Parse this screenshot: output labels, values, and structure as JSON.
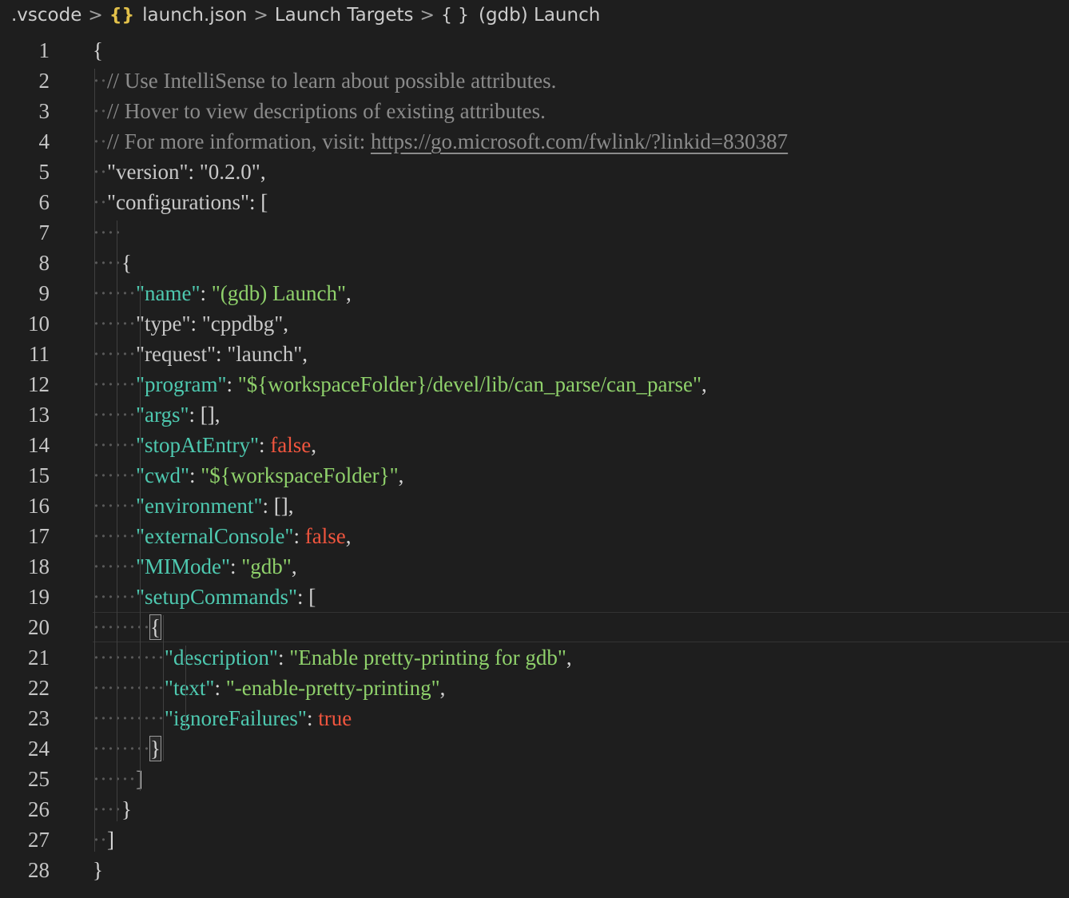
{
  "breadcrumb": {
    "folder": ".vscode",
    "file_icon": "{}",
    "file": "launch.json",
    "section": "Launch Targets",
    "object_icon": "{ }",
    "object": "(gdb) Launch",
    "separator": ">"
  },
  "icons": {
    "json_file_icon": "json-curly-braces-icon",
    "object_icon": "object-braces-icon",
    "chevron": "chevron-right-icon"
  },
  "colors": {
    "background": "#1e1e1e",
    "key": "#4ec9b0",
    "string": "#8fd16b",
    "keyword": "#f0553e",
    "comment": "#8b8b8b",
    "json_icon": "#e2c04a"
  },
  "editor": {
    "current_line": 20,
    "lines": [
      {
        "n": "1",
        "indent": "",
        "tokens": [
          {
            "t": "{",
            "c": "punc"
          }
        ]
      },
      {
        "n": "2",
        "indent": "··",
        "tokens": [
          {
            "t": "// Use IntelliSense to learn about possible attributes.",
            "c": "cm"
          }
        ]
      },
      {
        "n": "3",
        "indent": "··",
        "tokens": [
          {
            "t": "// Hover to view descriptions of existing attributes.",
            "c": "cm"
          }
        ]
      },
      {
        "n": "4",
        "indent": "··",
        "tokens": [
          {
            "t": "// For more information, visit: ",
            "c": "cm"
          },
          {
            "t": "https://go.microsoft.com/fwlink/?linkid=830387",
            "c": "link"
          }
        ]
      },
      {
        "n": "5",
        "indent": "··",
        "tokens": [
          {
            "t": "\"version\"",
            "c": "keyg"
          },
          {
            "t": ": ",
            "c": "punc"
          },
          {
            "t": "\"0.2.0\"",
            "c": "strg"
          },
          {
            "t": ",",
            "c": "punc"
          }
        ]
      },
      {
        "n": "6",
        "indent": "··",
        "tokens": [
          {
            "t": "\"configurations\"",
            "c": "keyg"
          },
          {
            "t": ": [",
            "c": "punc"
          }
        ]
      },
      {
        "n": "7",
        "indent": "····",
        "tokens": []
      },
      {
        "n": "8",
        "indent": "····",
        "tokens": [
          {
            "t": "{",
            "c": "punc"
          }
        ]
      },
      {
        "n": "9",
        "indent": "······",
        "tokens": [
          {
            "t": "\"name\"",
            "c": "key"
          },
          {
            "t": ": ",
            "c": "punc"
          },
          {
            "t": "\"(gdb) Launch\"",
            "c": "str"
          },
          {
            "t": ",",
            "c": "punc"
          }
        ]
      },
      {
        "n": "10",
        "indent": "······",
        "tokens": [
          {
            "t": "\"type\"",
            "c": "keyg"
          },
          {
            "t": ": ",
            "c": "punc"
          },
          {
            "t": "\"cppdbg\"",
            "c": "strg"
          },
          {
            "t": ",",
            "c": "punc"
          }
        ]
      },
      {
        "n": "11",
        "indent": "······",
        "tokens": [
          {
            "t": "\"request\"",
            "c": "keyg"
          },
          {
            "t": ": ",
            "c": "punc"
          },
          {
            "t": "\"launch\"",
            "c": "strg"
          },
          {
            "t": ",",
            "c": "punc"
          }
        ]
      },
      {
        "n": "12",
        "indent": "······",
        "tokens": [
          {
            "t": "\"program\"",
            "c": "key"
          },
          {
            "t": ": ",
            "c": "punc"
          },
          {
            "t": "\"${workspaceFolder}/devel/lib/can_parse/can_parse\"",
            "c": "str"
          },
          {
            "t": ",",
            "c": "punc"
          }
        ]
      },
      {
        "n": "13",
        "indent": "······",
        "tokens": [
          {
            "t": "\"args\"",
            "c": "key"
          },
          {
            "t": ": [],",
            "c": "punc"
          }
        ]
      },
      {
        "n": "14",
        "indent": "······",
        "tokens": [
          {
            "t": "\"stopAtEntry\"",
            "c": "key"
          },
          {
            "t": ": ",
            "c": "punc"
          },
          {
            "t": "false",
            "c": "kw"
          },
          {
            "t": ",",
            "c": "punc"
          }
        ]
      },
      {
        "n": "15",
        "indent": "······",
        "tokens": [
          {
            "t": "\"cwd\"",
            "c": "key"
          },
          {
            "t": ": ",
            "c": "punc"
          },
          {
            "t": "\"${workspaceFolder}\"",
            "c": "str"
          },
          {
            "t": ",",
            "c": "punc"
          }
        ]
      },
      {
        "n": "16",
        "indent": "······",
        "tokens": [
          {
            "t": "\"environment\"",
            "c": "key"
          },
          {
            "t": ": [],",
            "c": "punc"
          }
        ]
      },
      {
        "n": "17",
        "indent": "······",
        "tokens": [
          {
            "t": "\"externalConsole\"",
            "c": "key"
          },
          {
            "t": ": ",
            "c": "punc"
          },
          {
            "t": "false",
            "c": "kw"
          },
          {
            "t": ",",
            "c": "punc"
          }
        ]
      },
      {
        "n": "18",
        "indent": "······",
        "tokens": [
          {
            "t": "\"MIMode\"",
            "c": "key"
          },
          {
            "t": ": ",
            "c": "punc"
          },
          {
            "t": "\"gdb\"",
            "c": "str"
          },
          {
            "t": ",",
            "c": "punc"
          }
        ]
      },
      {
        "n": "19",
        "indent": "······",
        "tokens": [
          {
            "t": "\"setupCommands\"",
            "c": "key"
          },
          {
            "t": ": [",
            "c": "punc"
          }
        ]
      },
      {
        "n": "20",
        "indent": "········",
        "tokens": [
          {
            "t": "{",
            "c": "punc",
            "box": true
          }
        ]
      },
      {
        "n": "21",
        "indent": "··········",
        "tokens": [
          {
            "t": "\"description\"",
            "c": "key"
          },
          {
            "t": ": ",
            "c": "punc"
          },
          {
            "t": "\"Enable pretty-printing for gdb\"",
            "c": "str"
          },
          {
            "t": ",",
            "c": "punc"
          }
        ]
      },
      {
        "n": "22",
        "indent": "··········",
        "tokens": [
          {
            "t": "\"text\"",
            "c": "key"
          },
          {
            "t": ": ",
            "c": "punc"
          },
          {
            "t": "\"-enable-pretty-printing\"",
            "c": "str"
          },
          {
            "t": ",",
            "c": "punc"
          }
        ]
      },
      {
        "n": "23",
        "indent": "··········",
        "tokens": [
          {
            "t": "\"ignoreFailures\"",
            "c": "key"
          },
          {
            "t": ": ",
            "c": "punc"
          },
          {
            "t": "true",
            "c": "kw"
          }
        ]
      },
      {
        "n": "24",
        "indent": "········",
        "tokens": [
          {
            "t": "}",
            "c": "punc",
            "box": true
          }
        ]
      },
      {
        "n": "25",
        "indent": "······",
        "tokens": [
          {
            "t": "]",
            "c": "punc"
          }
        ]
      },
      {
        "n": "26",
        "indent": "····",
        "tokens": [
          {
            "t": "}",
            "c": "punc"
          }
        ]
      },
      {
        "n": "27",
        "indent": "··",
        "tokens": [
          {
            "t": "]",
            "c": "punc"
          }
        ]
      },
      {
        "n": "28",
        "indent": "",
        "tokens": [
          {
            "t": "}",
            "c": "punc"
          }
        ]
      }
    ]
  }
}
